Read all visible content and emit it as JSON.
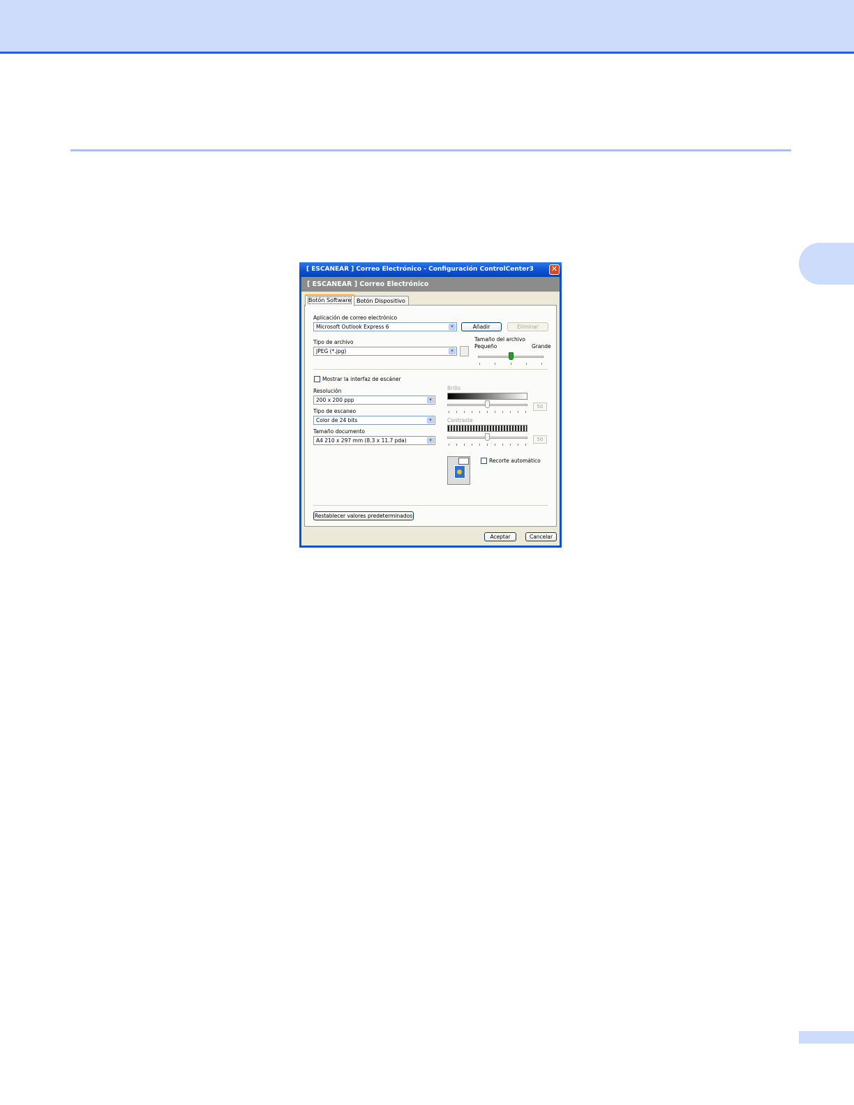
{
  "dialog": {
    "title": "[  ESCANEAR  ]   Correo Electrónico - Configuración ControlCenter3",
    "close_glyph": "✕",
    "band_title": "[  ESCANEAR  ]   Correo Electrónico",
    "tabs": [
      "Botón Software",
      "Botón Dispositivo"
    ],
    "email_app": {
      "label": "Aplicación de correo electrónico",
      "value": "Microsoft Outlook Express 6",
      "add_button": "Añadir",
      "delete_button": "Eliminar"
    },
    "file_type": {
      "label": "Tipo de archivo",
      "value": "JPEG (*.jpg)"
    },
    "file_size": {
      "label": "Tamaño del archivo",
      "small_label": "Pequeño",
      "large_label": "Grande",
      "level_fraction": 0.5
    },
    "show_scanner_interface": {
      "label": "Mostrar la interfaz de escáner",
      "checked": false
    },
    "resolution": {
      "label": "Resolución",
      "value": "200 x 200 ppp"
    },
    "scan_type": {
      "label": "Tipo de escaneo",
      "value": "Color de 24 bits"
    },
    "document_size": {
      "label": "Tamaño documento",
      "value": "A4 210 x 297 mm (8.3 x 11.7 pda)"
    },
    "brightness": {
      "label": "Brillo",
      "value": "50",
      "level_fraction": 0.5
    },
    "contrast": {
      "label": "Contraste",
      "value": "50",
      "level_fraction": 0.5
    },
    "auto_crop": {
      "label": "Recorte automático",
      "checked": false
    },
    "restore_defaults_button": "Restablecer valores predeterminados",
    "ok_button": "Aceptar",
    "cancel_button": "Cancelar"
  }
}
